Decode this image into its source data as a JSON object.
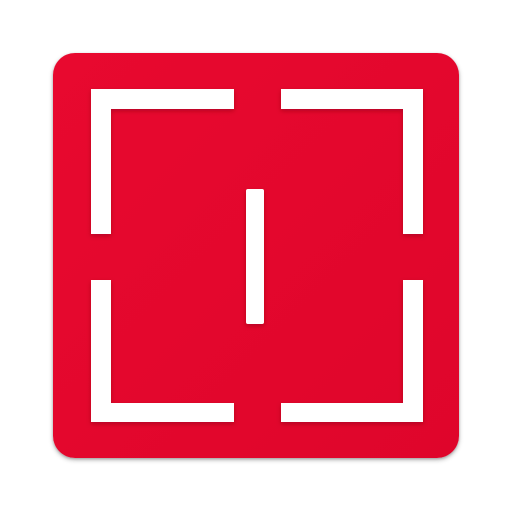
{
  "app_icon": {
    "icon": "scan-frame-icon",
    "background_color": "#E4082E",
    "foreground_color": "#FFFFFF"
  }
}
